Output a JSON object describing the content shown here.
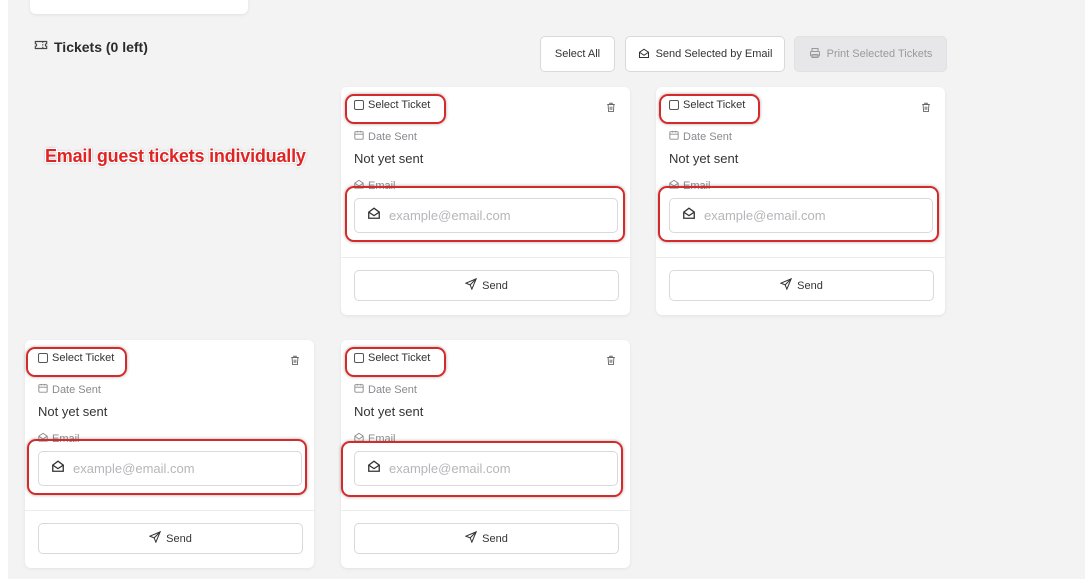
{
  "section": {
    "title": "Tickets (0 left)",
    "icon": "ticket-icon"
  },
  "toolbar": {
    "select_all_label": "Select All",
    "send_selected_label": "Send Selected by Email",
    "print_selected_label": "Print Selected Tickets"
  },
  "annotation": {
    "text": "Email guest tickets individually",
    "color": "#e02424"
  },
  "tickets": [
    {
      "select_label": "Select Ticket",
      "date_label": "Date Sent",
      "date_value": "Not yet sent",
      "email_label": "Email",
      "email_placeholder": "example@email.com",
      "send_label": "Send"
    },
    {
      "select_label": "Select Ticket",
      "date_label": "Date Sent",
      "date_value": "Not yet sent",
      "email_label": "Email",
      "email_placeholder": "example@email.com",
      "send_label": "Send"
    },
    {
      "select_label": "Select Ticket",
      "date_label": "Date Sent",
      "date_value": "Not yet sent",
      "email_label": "Email",
      "email_placeholder": "example@email.com",
      "send_label": "Send"
    },
    {
      "select_label": "Select Ticket",
      "date_label": "Date Sent",
      "date_value": "Not yet sent",
      "email_label": "Email",
      "email_placeholder": "example@email.com",
      "send_label": "Send"
    }
  ],
  "colors": {
    "highlight": "#d42a2a",
    "panel_bg": "#f3f3f4",
    "disabled_button_bg": "#e7e7e9"
  }
}
